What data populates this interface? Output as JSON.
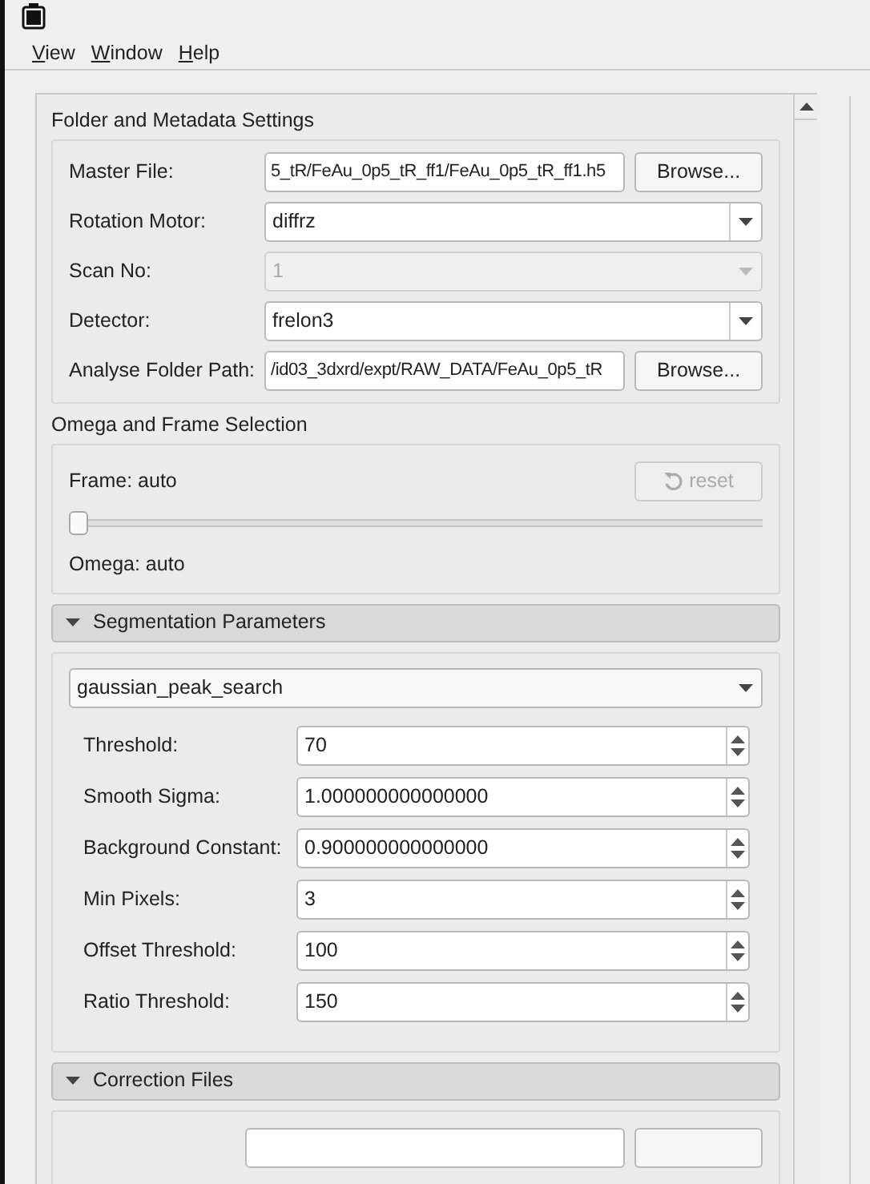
{
  "menu": [
    {
      "label": "View"
    },
    {
      "label": "Window"
    },
    {
      "label": "Help"
    }
  ],
  "folder_settings": {
    "title": "Folder and Metadata Settings",
    "rows": [
      {
        "kind": "file",
        "label": "Master File:",
        "value": "5_tR/FeAu_0p5_tR_ff1/FeAu_0p5_tR_ff1.h5",
        "button": "Browse..."
      },
      {
        "kind": "combo",
        "label": "Rotation Motor:",
        "value": "diffrz",
        "disabled": false
      },
      {
        "kind": "combo",
        "label": "Scan No:",
        "value": "1",
        "disabled": true
      },
      {
        "kind": "combo",
        "label": "Detector:",
        "value": "frelon3",
        "disabled": false
      },
      {
        "kind": "file",
        "label": "Analyse Folder Path:",
        "value": "/id03_3dxrd/expt/RAW_DATA/FeAu_0p5_tR",
        "button": "Browse..."
      }
    ]
  },
  "omega_frame": {
    "title": "Omega and Frame Selection",
    "frame_label": "Frame: auto",
    "reset_button": {
      "label": "reset",
      "disabled": true
    },
    "slider": {
      "level": 0
    },
    "omega_label": "Omega: auto"
  },
  "segmentation": {
    "title": "Segmentation Parameters",
    "expanded": true,
    "method": "gaussian_peak_search",
    "params": [
      {
        "label": "Threshold:",
        "value": "70"
      },
      {
        "label": "Smooth Sigma:",
        "value": "1.000000000000000"
      },
      {
        "label": "Background Constant:",
        "value": "0.900000000000000"
      },
      {
        "label": "Min Pixels:",
        "value": "3"
      },
      {
        "label": "Offset Threshold:",
        "value": "100"
      },
      {
        "label": "Ratio Threshold:",
        "value": "150"
      }
    ]
  },
  "correction": {
    "title": "Correction Files",
    "expanded": true
  }
}
